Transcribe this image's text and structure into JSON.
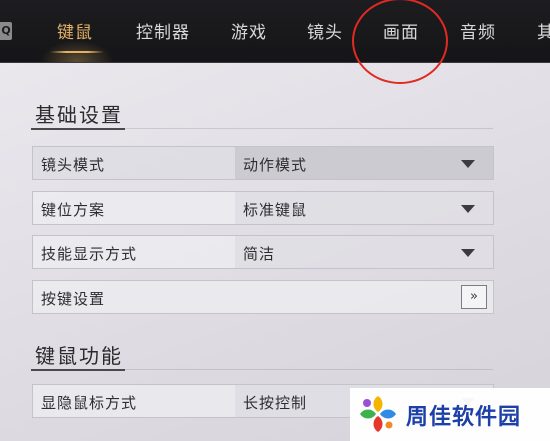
{
  "nav": {
    "q_key": "Q",
    "tabs": [
      {
        "label": "键鼠",
        "active": true
      },
      {
        "label": "控制器",
        "active": false
      },
      {
        "label": "游戏",
        "active": false
      },
      {
        "label": "镜头",
        "active": false
      },
      {
        "label": "画面",
        "active": false
      },
      {
        "label": "音频",
        "active": false
      },
      {
        "label": "其",
        "active": false
      }
    ]
  },
  "sections": {
    "basic": {
      "title": "基础设置",
      "rows": [
        {
          "label": "镜头模式",
          "value": "动作模式",
          "control": "dropdown"
        },
        {
          "label": "键位方案",
          "value": "标准键鼠",
          "control": "dropdown"
        },
        {
          "label": "技能显示方式",
          "value": "简洁",
          "control": "dropdown"
        },
        {
          "label": "按键设置",
          "control": "arrow-button",
          "button_label": "»"
        }
      ]
    },
    "mouse": {
      "title": "键鼠功能",
      "rows": [
        {
          "label": "显隐鼠标方式",
          "value": "长按控制",
          "control": "dropdown"
        }
      ]
    }
  },
  "watermark": {
    "text": "周佳软件园"
  },
  "colors": {
    "nav_bg": "#1a1a1c",
    "tab_active": "#e2b163",
    "tab_inactive": "#d8d8d8",
    "annotation_circle": "#e02a22",
    "watermark_text": "#1d3fa8"
  },
  "icons": [
    "q-key-icon",
    "dropdown-caret-icon",
    "double-chevron-right-icon",
    "watermark-logo-icon"
  ]
}
